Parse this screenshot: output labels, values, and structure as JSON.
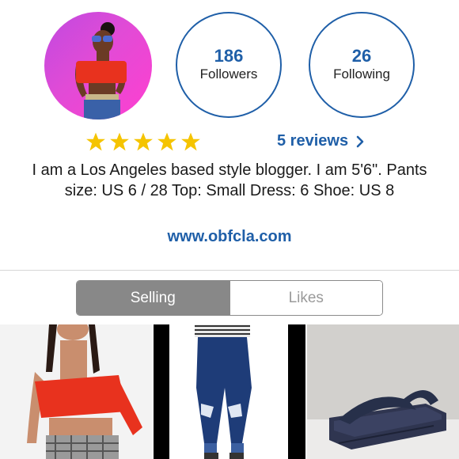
{
  "profile": {
    "followers_count": "186",
    "followers_label": "Followers",
    "following_count": "26",
    "following_label": "Following",
    "rating_stars": 5,
    "reviews_label": "5 reviews",
    "bio": "I am a Los Angeles based style blogger. I am 5'6\". Pants size: US 6 / 28 Top: Small Dress: 6 Shoe: US 8",
    "website": "www.obfcla.com"
  },
  "tabs": {
    "selling_label": "Selling",
    "likes_label": "Likes",
    "active": "Selling"
  },
  "colors": {
    "accent": "#1f5fa8",
    "star": "#f5c400",
    "segment_active": "#888888"
  }
}
